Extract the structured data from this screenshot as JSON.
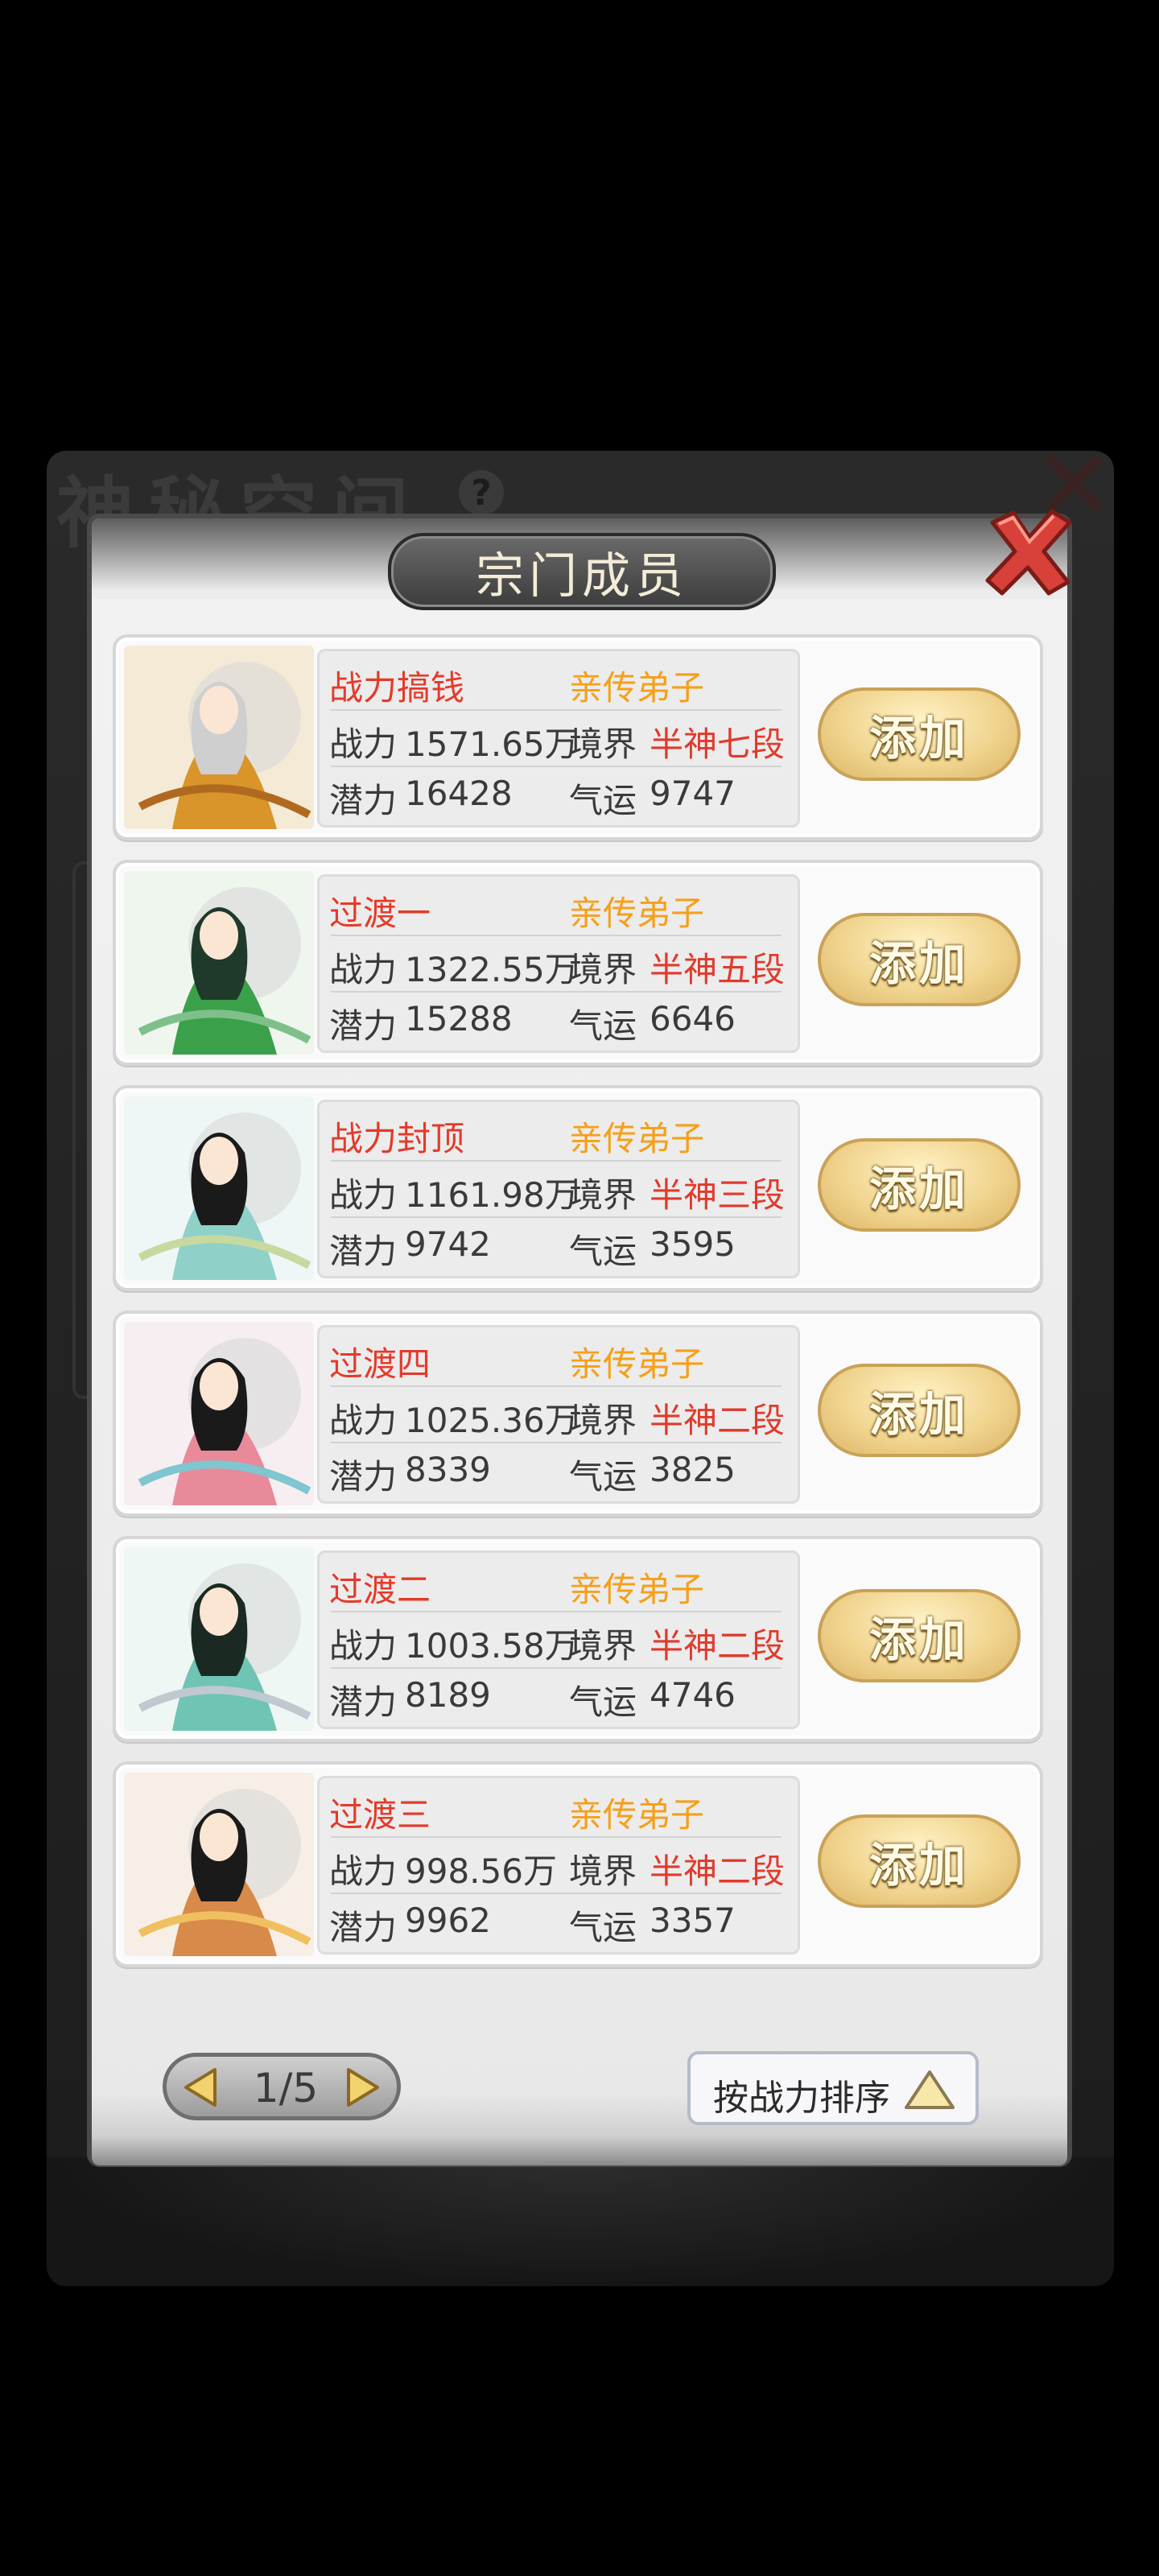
{
  "background": {
    "title": "神秘空间",
    "help_symbol": "?",
    "close_symbol": "✕"
  },
  "dialog": {
    "title": "宗门成员",
    "close_symbol": "✕"
  },
  "labels": {
    "power": "战力",
    "realm": "境界",
    "potential": "潜力",
    "luck": "气运",
    "add": "添加"
  },
  "members": [
    {
      "name": "战力搞钱",
      "rank": "亲传弟子",
      "power": "1571.65万",
      "realm": "半神七段",
      "potential": "16428",
      "luck": "9747"
    },
    {
      "name": "过渡一",
      "rank": "亲传弟子",
      "power": "1322.55万",
      "realm": "半神五段",
      "potential": "15288",
      "luck": "6646"
    },
    {
      "name": "战力封顶",
      "rank": "亲传弟子",
      "power": "1161.98万",
      "realm": "半神三段",
      "potential": "9742",
      "luck": "3595"
    },
    {
      "name": "过渡四",
      "rank": "亲传弟子",
      "power": "1025.36万",
      "realm": "半神二段",
      "potential": "8339",
      "luck": "3825"
    },
    {
      "name": "过渡二",
      "rank": "亲传弟子",
      "power": "1003.58万",
      "realm": "半神二段",
      "potential": "8189",
      "luck": "4746"
    },
    {
      "name": "过渡三",
      "rank": "亲传弟子",
      "power": "998.56万",
      "realm": "半神二段",
      "potential": "9962",
      "luck": "3357"
    }
  ],
  "pagination": {
    "text": "1/5"
  },
  "sort": {
    "label": "按战力排序"
  },
  "colors": {
    "name_red": "#e43a2a",
    "rank_orange": "#f5a01a",
    "realm_red": "#e03a2c",
    "button_gold": "#f1d590"
  }
}
